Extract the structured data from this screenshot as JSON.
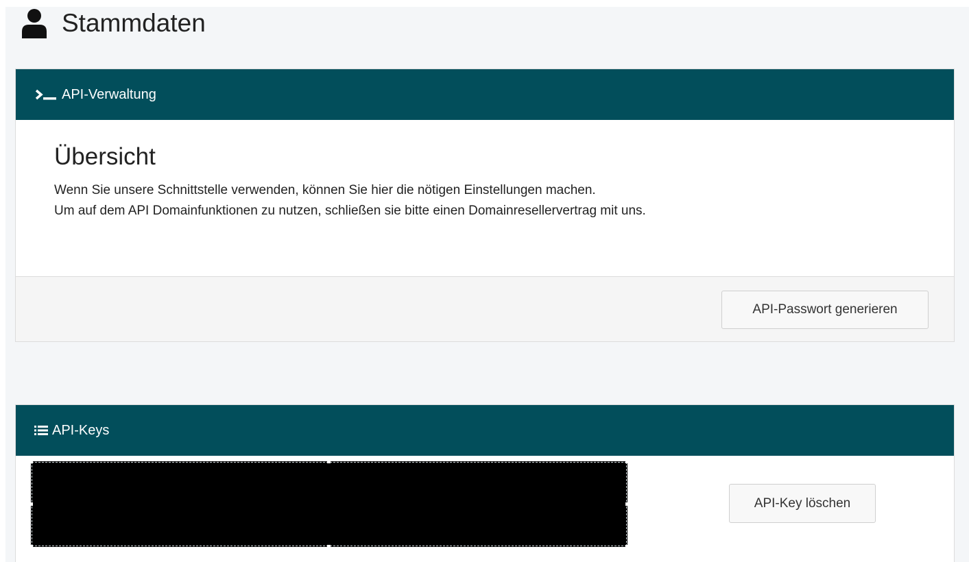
{
  "page": {
    "title": "Stammdaten",
    "title_icon": "user-icon"
  },
  "api_management": {
    "heading": "API-Verwaltung",
    "heading_icon": "terminal-icon",
    "overview_title": "Übersicht",
    "description_line1": "Wenn Sie unsere Schnittstelle verwenden, können Sie hier die nötigen Einstellungen machen.",
    "description_line2": "Um auf dem API Domainfunktionen zu nutzen, schließen sie bitte einen Domainresellervertrag mit uns.",
    "generate_password_label": "API-Passwort generieren"
  },
  "api_keys": {
    "heading": "API-Keys",
    "heading_icon": "list-icon",
    "delete_key_label": "API-Key löschen"
  },
  "colors": {
    "header_bg": "#024e5b",
    "page_bg": "#f4f6f8",
    "redaction": "#000000"
  }
}
